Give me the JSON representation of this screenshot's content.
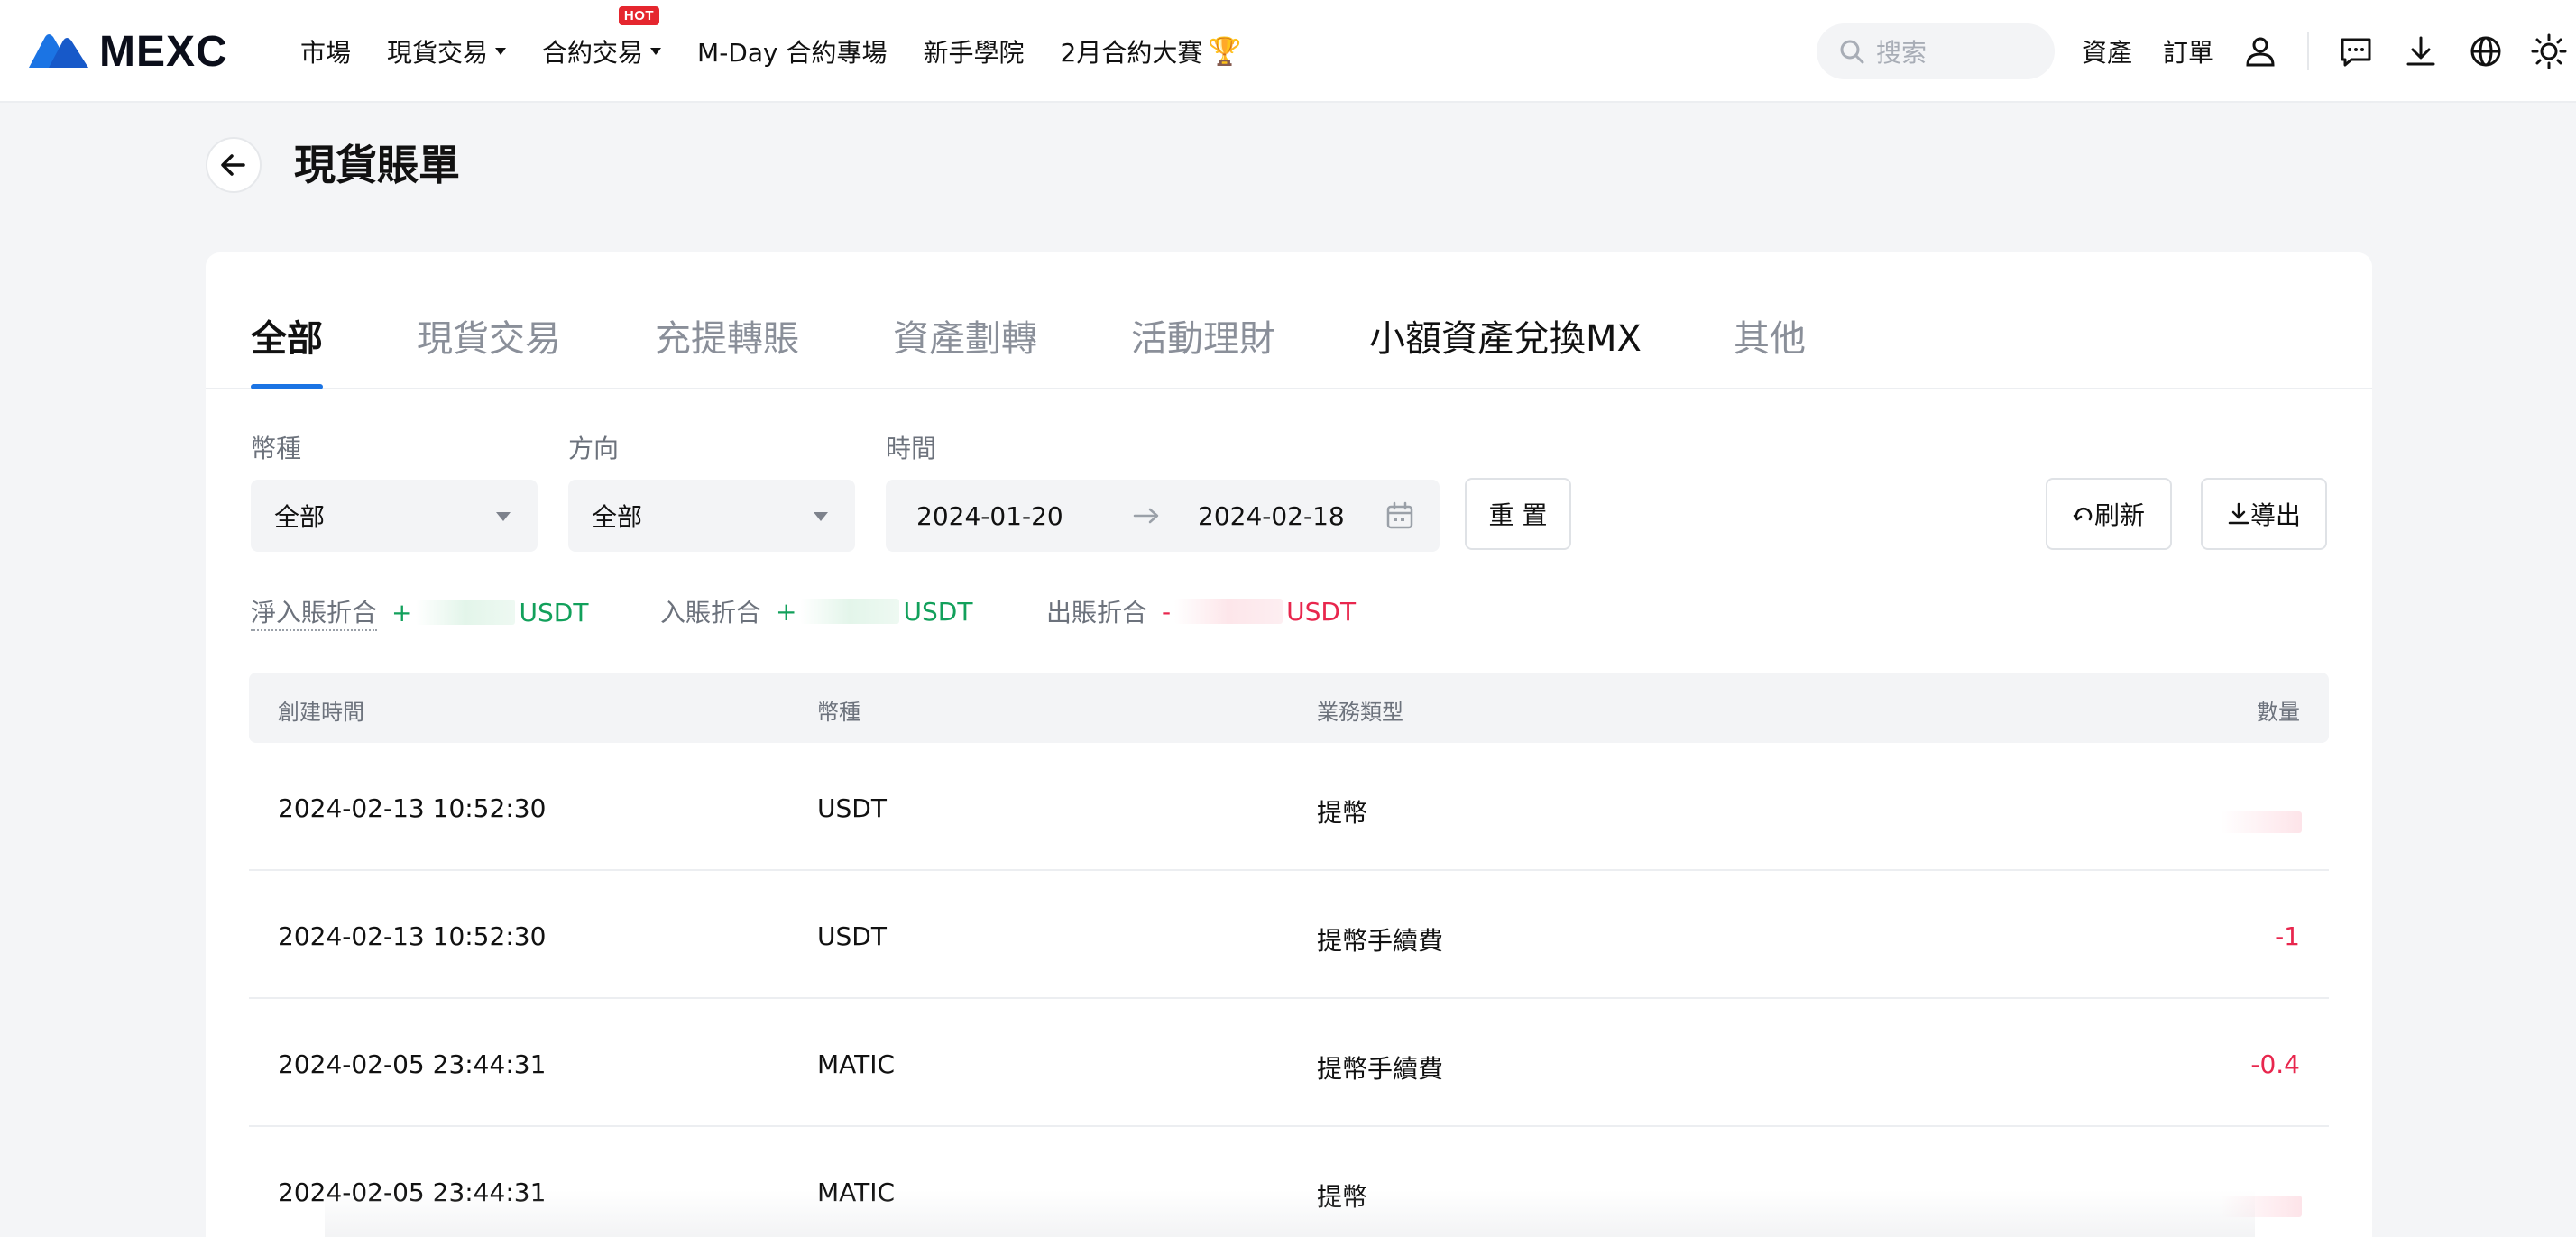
{
  "nav": {
    "logo_text": "MEXC",
    "items": [
      {
        "label": "市場",
        "dropdown": false
      },
      {
        "label": "現貨交易",
        "dropdown": true
      },
      {
        "label": "合約交易",
        "dropdown": true,
        "badge": "HOT"
      },
      {
        "label": "M-Day 合約專場",
        "dropdown": false
      },
      {
        "label": "新手學院",
        "dropdown": false
      },
      {
        "label": "2月合約大賽",
        "dropdown": false
      }
    ],
    "search_placeholder": "搜索",
    "right_links": [
      "資產",
      "訂單"
    ]
  },
  "page": {
    "title": "現貨賬單"
  },
  "tabs": [
    "全部",
    "現貨交易",
    "充提轉賬",
    "資產劃轉",
    "活動理財",
    "小額資產兌換MX",
    "其他"
  ],
  "filters": {
    "currency_label": "幣種",
    "currency_value": "全部",
    "direction_label": "方向",
    "direction_value": "全部",
    "time_label": "時間",
    "date_start": "2024-01-20",
    "date_end": "2024-02-18",
    "reset_label": "重 置",
    "refresh_label": "刷新",
    "export_label": "導出"
  },
  "summary": {
    "net_label": "淨入賬折合",
    "net_sign": "+",
    "net_unit": "USDT",
    "in_label": "入賬折合",
    "in_sign": "+",
    "in_unit": "USDT",
    "out_label": "出賬折合",
    "out_sign": "-",
    "out_unit": "USDT"
  },
  "table": {
    "headers": [
      "創建時間",
      "幣種",
      "業務類型",
      "數量"
    ],
    "rows": [
      {
        "time": "2024-02-13 10:52:30",
        "coin": "USDT",
        "type": "提幣",
        "amount": ""
      },
      {
        "time": "2024-02-13 10:52:30",
        "coin": "USDT",
        "type": "提幣手續費",
        "amount": "-1"
      },
      {
        "time": "2024-02-05 23:44:31",
        "coin": "MATIC",
        "type": "提幣手續費",
        "amount": "-0.4"
      },
      {
        "time": "2024-02-05 23:44:31",
        "coin": "MATIC",
        "type": "提幣",
        "amount": ""
      }
    ]
  },
  "colors": {
    "accent": "#1b74e4",
    "positive": "#12a05b",
    "negative": "#e8264d"
  }
}
